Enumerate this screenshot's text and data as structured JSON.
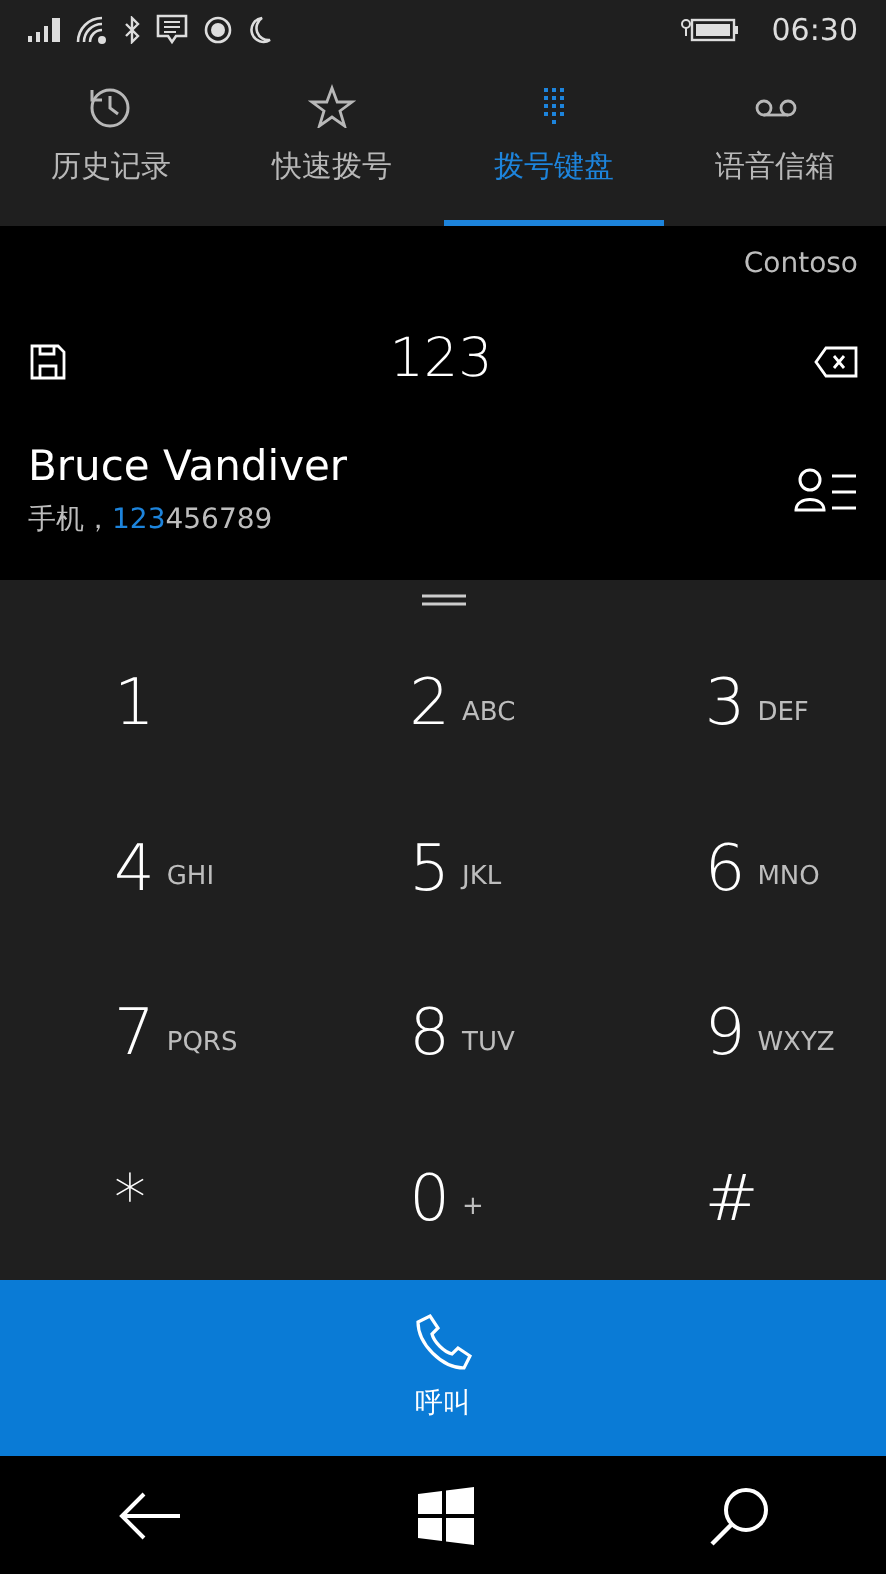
{
  "status_bar": {
    "time": "06:30"
  },
  "tabs": [
    {
      "label": "历史记录",
      "selected": false
    },
    {
      "label": "快速拨号",
      "selected": false
    },
    {
      "label": "拨号键盘",
      "selected": true
    },
    {
      "label": "语音信箱",
      "selected": false
    }
  ],
  "carrier": "Contoso",
  "dialed_number": "123",
  "suggestion": {
    "name": "Bruce Vandiver",
    "number_type": "手机，",
    "number_match": "123",
    "number_rest": "456789"
  },
  "keys": [
    {
      "digit": "1"
    },
    {
      "digit": "2",
      "letters": "ABC"
    },
    {
      "digit": "3",
      "letters": "DEF"
    },
    {
      "digit": "4",
      "letters": "GHI"
    },
    {
      "digit": "5",
      "letters": "JKL"
    },
    {
      "digit": "6",
      "letters": "MNO"
    },
    {
      "digit": "7",
      "letters": "PQRS"
    },
    {
      "digit": "8",
      "letters": "TUV"
    },
    {
      "digit": "9",
      "letters": "WXYZ"
    },
    {
      "digit": "*"
    },
    {
      "digit": "0",
      "letters": "+"
    },
    {
      "digit": "#"
    }
  ],
  "call_button": {
    "label": "呼叫"
  }
}
